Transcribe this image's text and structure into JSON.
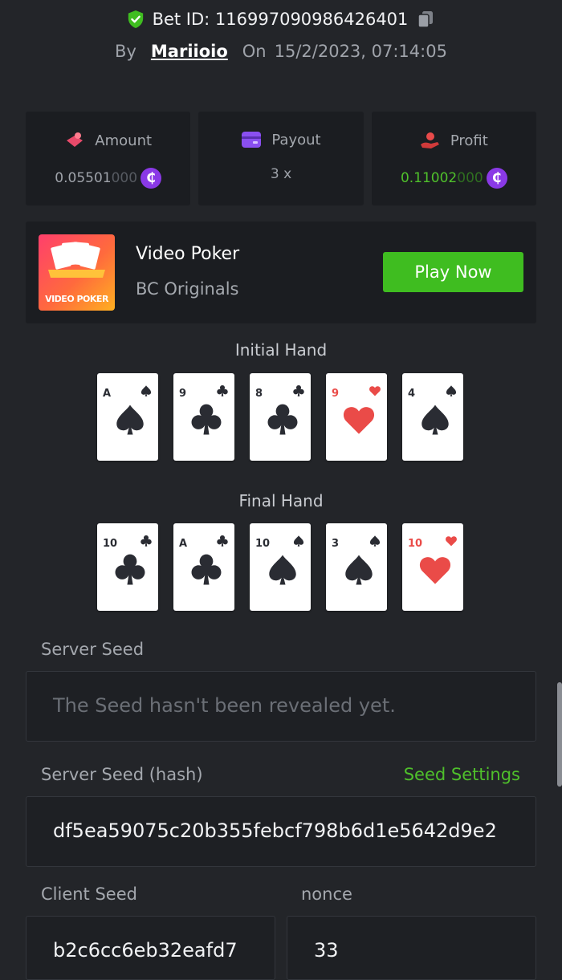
{
  "header": {
    "bet_id_label": "Bet ID: 116997090986426401",
    "by_label": "By",
    "username": "Mariioio",
    "on_label": "On",
    "datetime": "15/2/2023, 07:14:05"
  },
  "stats": {
    "amount": {
      "label": "Amount",
      "value_main": "0.05501",
      "value_dim": "000",
      "icon": "amount-icon"
    },
    "payout": {
      "label": "Payout",
      "value": "3 x",
      "icon": "payout-card-icon"
    },
    "profit": {
      "label": "Profit",
      "value_main": "0.11002",
      "value_dim": "000",
      "icon": "profit-icon"
    },
    "coin_symbol": "₵"
  },
  "game": {
    "thumb_label": "VIDEO POKER",
    "name": "Video Poker",
    "provider": "BC Originals",
    "play_label": "Play Now"
  },
  "initial_hand": {
    "title": "Initial Hand",
    "cards": [
      {
        "rank": "A",
        "suit": "spade"
      },
      {
        "rank": "9",
        "suit": "club"
      },
      {
        "rank": "8",
        "suit": "club"
      },
      {
        "rank": "9",
        "suit": "heart"
      },
      {
        "rank": "4",
        "suit": "spade"
      }
    ]
  },
  "final_hand": {
    "title": "Final Hand",
    "cards": [
      {
        "rank": "10",
        "suit": "club"
      },
      {
        "rank": "A",
        "suit": "club"
      },
      {
        "rank": "10",
        "suit": "spade"
      },
      {
        "rank": "3",
        "suit": "spade"
      },
      {
        "rank": "10",
        "suit": "heart"
      }
    ]
  },
  "server_seed": {
    "label": "Server Seed",
    "value": "The Seed hasn't been revealed yet."
  },
  "server_seed_hash": {
    "label": "Server Seed (hash)",
    "settings_link": "Seed Settings",
    "value": "df5ea59075c20b355febcf798b6d1e5642d9e2"
  },
  "client_seed": {
    "label": "Client Seed",
    "value": "b2c6cc6eb32eafd7"
  },
  "nonce": {
    "label": "nonce",
    "value": "33"
  },
  "colors": {
    "accent_green": "#3fbd20",
    "coin_purple": "#8a39e6",
    "heart_red": "#ea4b48"
  }
}
